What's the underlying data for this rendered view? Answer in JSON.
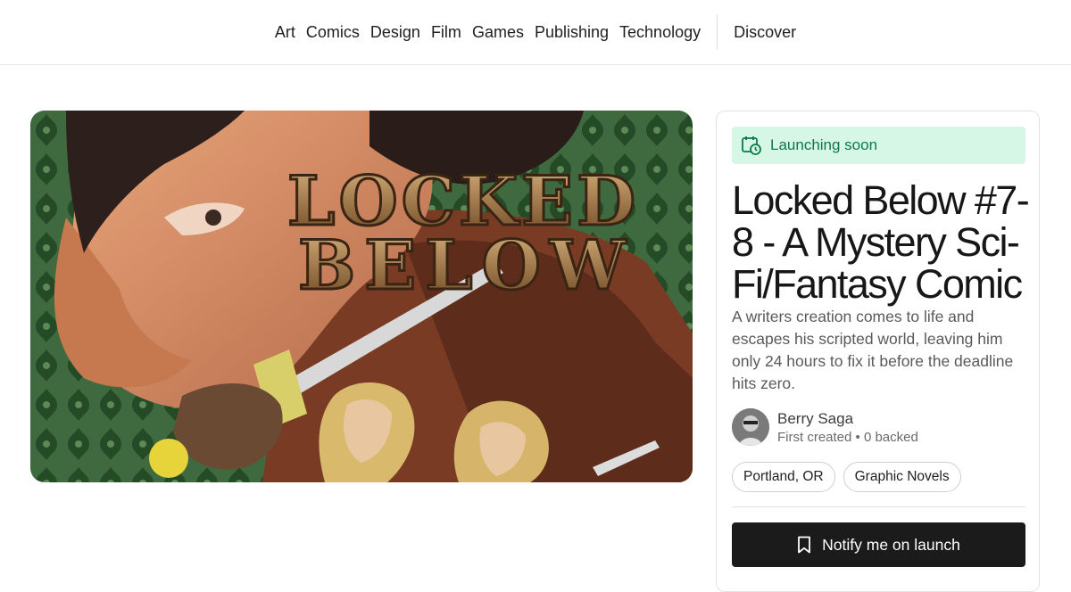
{
  "nav": {
    "categories": [
      "Art",
      "Comics",
      "Design",
      "Film",
      "Games",
      "Publishing",
      "Technology"
    ],
    "discover": "Discover"
  },
  "hero": {
    "artwork_alt_lines": [
      "LOCKED",
      "BELOW"
    ]
  },
  "project": {
    "status": "Launching soon",
    "status_icon": "calendar-clock-icon",
    "title": "Locked Below #7-8 - A Mystery Sci-Fi/Fantasy Comic",
    "blurb": "A writers creation comes to life and escapes his scripted world, leaving him only 24 hours to fix it before the deadline hits zero.",
    "creator": {
      "name": "Berry Saga",
      "meta": "First created • 0 backed"
    },
    "tags": [
      "Portland, OR",
      "Graphic Novels"
    ],
    "notify_label": "Notify me on launch",
    "notify_icon": "bookmark-icon"
  },
  "colors": {
    "status_bg": "#d7f7e6",
    "status_text": "#0a7a47",
    "button_bg": "#1b1b1b"
  }
}
